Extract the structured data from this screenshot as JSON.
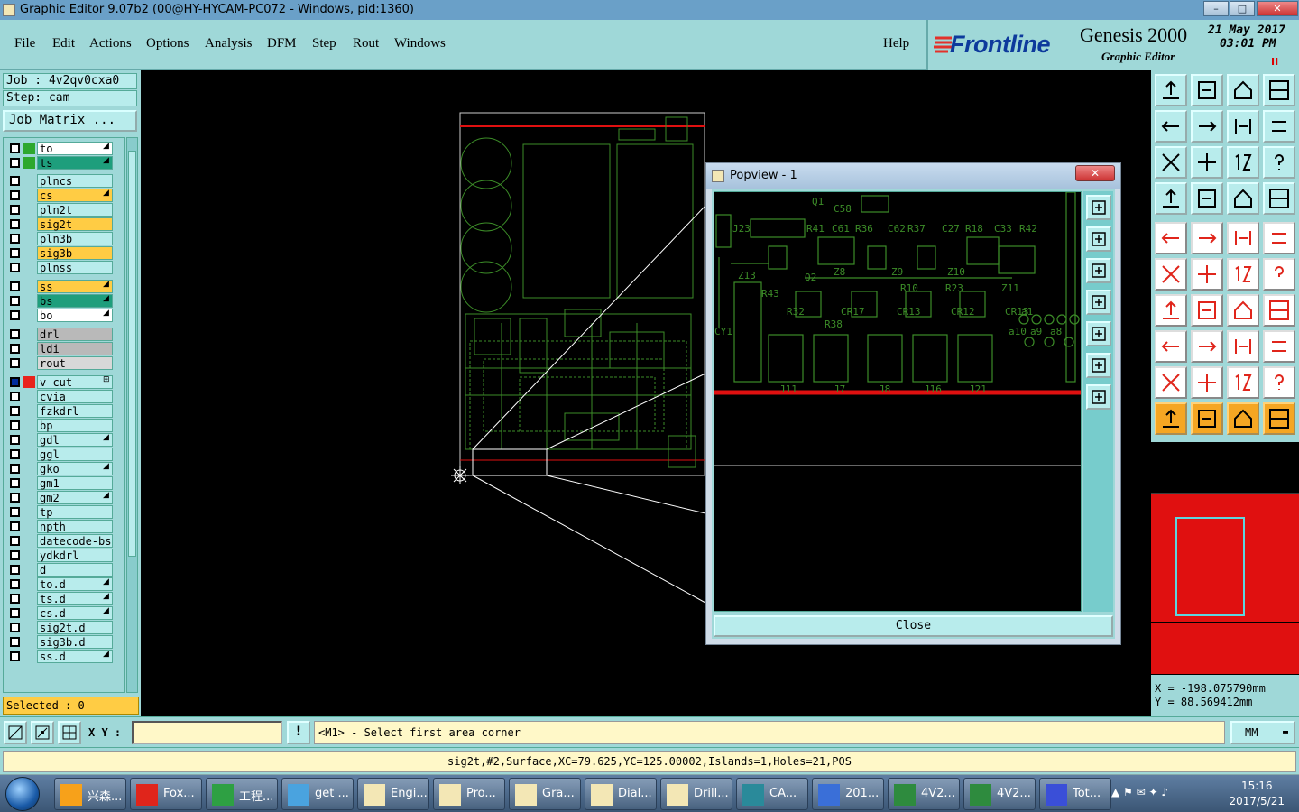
{
  "window": {
    "title": "Graphic Editor 9.07b2 (00@HY-HYCAM-PC072 - Windows, pid:1360)",
    "minimize": "–",
    "maximize": "□",
    "close": "✕"
  },
  "menu": [
    "File",
    "Edit",
    "Actions",
    "Options",
    "Analysis",
    "DFM",
    "Step",
    "Rout",
    "Windows",
    "Help"
  ],
  "branding": {
    "brand": "Frontline",
    "product": "Genesis 2000",
    "subtitle": "Graphic Editor",
    "date": "21 May 2017",
    "time": "03:01 PM",
    "pause": "II"
  },
  "job": {
    "job_line": "Job : 4v2qv0cxa0",
    "step_line": "Step: cam",
    "matrix_button": "Job Matrix ..."
  },
  "layers": [
    {
      "name": "to",
      "bg": "#ffffff",
      "swatch": "#2da82d",
      "mark": "◢"
    },
    {
      "name": "ts",
      "bg": "#1e9e7c",
      "swatch": "#2da82d",
      "mark": "◢"
    },
    {
      "name": "plncs",
      "bg": "#b8ecec",
      "swatch": "",
      "mark": ""
    },
    {
      "name": "cs",
      "bg": "#ffcc44",
      "swatch": "",
      "mark": "◢"
    },
    {
      "name": "pln2t",
      "bg": "#b8ecec",
      "swatch": "",
      "mark": ""
    },
    {
      "name": "sig2t",
      "bg": "#ffcc44",
      "swatch": "",
      "mark": ""
    },
    {
      "name": "pln3b",
      "bg": "#b8ecec",
      "swatch": "",
      "mark": ""
    },
    {
      "name": "sig3b",
      "bg": "#ffcc44",
      "swatch": "",
      "mark": ""
    },
    {
      "name": "plnss",
      "bg": "#b8ecec",
      "swatch": "",
      "mark": ""
    },
    {
      "name": "ss",
      "bg": "#ffcc44",
      "swatch": "",
      "mark": "◢"
    },
    {
      "name": "bs",
      "bg": "#1e9e7c",
      "swatch": "",
      "mark": "◢"
    },
    {
      "name": "bo",
      "bg": "#ffffff",
      "swatch": "",
      "mark": "◢"
    },
    {
      "name": "drl",
      "bg": "#b9b9b9",
      "swatch": "",
      "mark": ""
    },
    {
      "name": "ldi",
      "bg": "#b9b9b9",
      "swatch": "",
      "mark": ""
    },
    {
      "name": "rout",
      "bg": "#d8d8d8",
      "swatch": "",
      "mark": ""
    },
    {
      "name": "v-cut",
      "bg": "#b8ecec",
      "swatch": "#e8231c",
      "mark": "⊞",
      "checked": true
    },
    {
      "name": "cvia",
      "bg": "#b8ecec",
      "swatch": "",
      "mark": ""
    },
    {
      "name": "fzkdrl",
      "bg": "#b8ecec",
      "swatch": "",
      "mark": ""
    },
    {
      "name": "bp",
      "bg": "#b8ecec",
      "swatch": "",
      "mark": ""
    },
    {
      "name": "gdl",
      "bg": "#b8ecec",
      "swatch": "",
      "mark": "◢"
    },
    {
      "name": "ggl",
      "bg": "#b8ecec",
      "swatch": "",
      "mark": ""
    },
    {
      "name": "gko",
      "bg": "#b8ecec",
      "swatch": "",
      "mark": "◢"
    },
    {
      "name": "gm1",
      "bg": "#b8ecec",
      "swatch": "",
      "mark": ""
    },
    {
      "name": "gm2",
      "bg": "#b8ecec",
      "swatch": "",
      "mark": "◢"
    },
    {
      "name": "tp",
      "bg": "#b8ecec",
      "swatch": "",
      "mark": ""
    },
    {
      "name": "npth",
      "bg": "#b8ecec",
      "swatch": "",
      "mark": ""
    },
    {
      "name": "datecode-bs",
      "bg": "#b8ecec",
      "swatch": "",
      "mark": ""
    },
    {
      "name": "ydkdrl",
      "bg": "#b8ecec",
      "swatch": "",
      "mark": ""
    },
    {
      "name": "d",
      "bg": "#b8ecec",
      "swatch": "",
      "mark": ""
    },
    {
      "name": "to.d",
      "bg": "#b8ecec",
      "swatch": "",
      "mark": "◢"
    },
    {
      "name": "ts.d",
      "bg": "#b8ecec",
      "swatch": "",
      "mark": "◢"
    },
    {
      "name": "cs.d",
      "bg": "#b8ecec",
      "swatch": "",
      "mark": "◢"
    },
    {
      "name": "sig2t.d",
      "bg": "#b8ecec",
      "swatch": "",
      "mark": ""
    },
    {
      "name": "sig3b.d",
      "bg": "#b8ecec",
      "swatch": "",
      "mark": ""
    },
    {
      "name": "ss.d",
      "bg": "#b8ecec",
      "swatch": "",
      "mark": "◢"
    }
  ],
  "selected": "Selected : 0",
  "popview": {
    "title": "Popview - 1",
    "close_x": "✕",
    "close_button": "Close",
    "labels": [
      "Q1",
      "C58",
      "J23",
      "R41",
      "C61",
      "R36",
      "C62",
      "R37",
      "C27",
      "R18",
      "C33",
      "R42",
      "Z8",
      "Z9",
      "Z10",
      "Z13",
      "Q2",
      "R10",
      "R23",
      "Z11",
      "R43",
      "R32",
      "CR17",
      "CR13",
      "CR12",
      "CR13",
      "R38",
      "a1",
      "a10",
      "a9",
      "a8",
      "CY1",
      "J11",
      "J7",
      "J8",
      "J16",
      "J21"
    ]
  },
  "coords": {
    "x": "X = -198.075790mm",
    "y": "Y =  88.569412mm"
  },
  "command": {
    "xy_label": "X Y :",
    "xy_value": "",
    "alert": "!",
    "prompt": "<M1> - Select first area corner",
    "units": "MM"
  },
  "info": "sig2t,#2,Surface,XC=79.625,YC=125.00002,Islands=1,Holes=21,POS",
  "taskbar": {
    "items": [
      "兴森...",
      "Fox...",
      "工程...",
      "get ...",
      "Engi...",
      "Pro...",
      "Gra...",
      "Dial...",
      "Drill...",
      "CA...",
      "201...",
      "4V2...",
      "4V2...",
      "Tot..."
    ],
    "time": "15:16",
    "date": "2017/5/21"
  }
}
